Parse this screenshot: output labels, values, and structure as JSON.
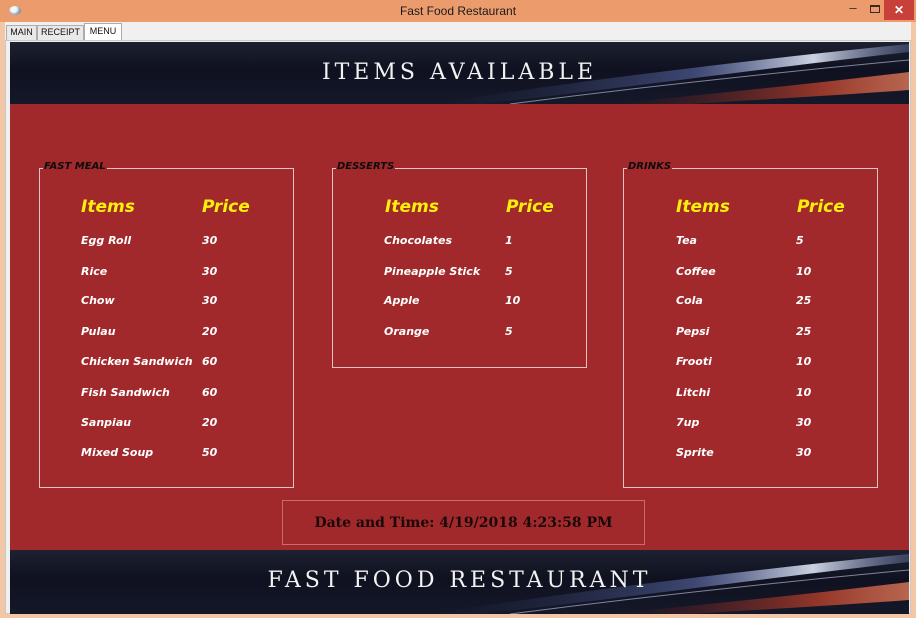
{
  "window": {
    "title": "Fast Food Restaurant"
  },
  "tabs": [
    "MAIN",
    "RECEIPT",
    "MENU"
  ],
  "header": {
    "title": "ITEMS AVAILABLE"
  },
  "footer": {
    "title": "FAST FOOD RESTAURANT"
  },
  "groups": {
    "fast_meal": {
      "legend": "FAST MEAL",
      "items_header": "Items",
      "price_header": "Price",
      "rows": [
        {
          "name": "Egg Roll",
          "price": "30"
        },
        {
          "name": "Rice",
          "price": "30"
        },
        {
          "name": "Chow",
          "price": "30"
        },
        {
          "name": "Pulau",
          "price": "20"
        },
        {
          "name": "Chicken Sandwich",
          "price": "60"
        },
        {
          "name": "Fish Sandwich",
          "price": "60"
        },
        {
          "name": "Sanpiau",
          "price": "20"
        },
        {
          "name": "Mixed Soup",
          "price": "50"
        }
      ]
    },
    "desserts": {
      "legend": "DESSERTS",
      "items_header": "Items",
      "price_header": "Price",
      "rows": [
        {
          "name": "Chocolates",
          "price": "1"
        },
        {
          "name": "Pineapple Stick",
          "price": "5"
        },
        {
          "name": "Apple",
          "price": "10"
        },
        {
          "name": "Orange",
          "price": "5"
        }
      ]
    },
    "drinks": {
      "legend": "DRINKS",
      "items_header": "Items",
      "price_header": "Price",
      "rows": [
        {
          "name": "Tea",
          "price": "5"
        },
        {
          "name": "Coffee",
          "price": "10"
        },
        {
          "name": "Cola",
          "price": "25"
        },
        {
          "name": "Pepsi",
          "price": "25"
        },
        {
          "name": "Frooti",
          "price": "10"
        },
        {
          "name": "Litchi",
          "price": "10"
        },
        {
          "name": "7up",
          "price": "30"
        },
        {
          "name": "Sprite",
          "price": "30"
        }
      ]
    }
  },
  "datetime": {
    "text": "Date and Time: 4/19/2018 4:23:58 PM"
  },
  "colors": {
    "background": "#a1292b",
    "header_text": "#ffef0c",
    "banner": "#0f1120"
  }
}
